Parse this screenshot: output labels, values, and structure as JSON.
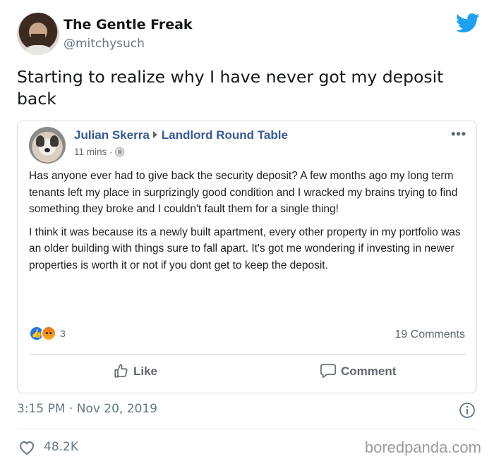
{
  "tweet": {
    "display_name": "The Gentle Freak",
    "handle": "@mitchysuch",
    "text": "Starting to realize why I have never got my deposit back",
    "timestamp": "3:15 PM · Nov 20, 2019",
    "like_count": "48.2K",
    "brand_color": "#1da1f2",
    "icons": [
      "twitter-bird-icon",
      "info-icon",
      "heart-icon"
    ]
  },
  "fb_post": {
    "author": "Julian Skerra",
    "group": "Landlord Round Table",
    "time_ago": "11 mins ·",
    "paragraphs": [
      "Has anyone ever had to give back the security deposit? A few months ago my long term tenants left my place in surprizingly good condition and I wracked my brains trying to find something they broke and I couldn't fault them for a single thing!",
      "I think it was because its a newly built apartment, every other property in my portfolio was an older building with things sure to fall apart. It's got me wondering if investing in newer properties is worth it or not if you dont get to keep the deposit."
    ],
    "reaction_count": "3",
    "comments_count": "19 Comments",
    "like_label": "Like",
    "comment_label": "Comment",
    "link_color": "#385898",
    "icons": [
      "globe-icon",
      "more-icon",
      "like-reaction-icon",
      "angry-reaction-icon",
      "thumbs-up-icon",
      "comment-icon"
    ]
  },
  "watermark": "boredpanda.com"
}
